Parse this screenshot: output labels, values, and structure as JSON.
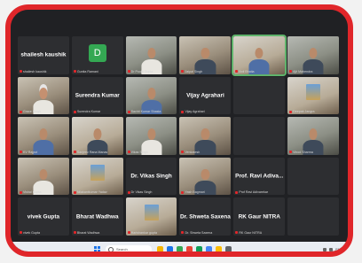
{
  "meeting": {
    "tiles": [
      {
        "kind": "name",
        "big": "shailesh kaushik",
        "tag": "shailesh kaushik"
      },
      {
        "kind": "avatar",
        "letter": "D",
        "tag": "Gunita Ramani"
      },
      {
        "kind": "video",
        "tag": "Dr Pooja Gupta"
      },
      {
        "kind": "video",
        "tag": "Jaipal Singh"
      },
      {
        "kind": "video",
        "active": true,
        "tag": "Anil Bhatia"
      },
      {
        "kind": "video",
        "tag": "Ajit Mahendra"
      },
      {
        "kind": "video",
        "tag": "Grace Singh"
      },
      {
        "kind": "name",
        "big": "Surendra Kumar",
        "tag": "Surendra Kumar"
      },
      {
        "kind": "video",
        "tag": "Sachit Kumar Shasta"
      },
      {
        "kind": "name",
        "big": "Vijay Agrahari",
        "tag": "Vijay Agrahari"
      },
      {
        "kind": "blank",
        "tag": ""
      },
      {
        "kind": "image",
        "tag": "Deepak Jangra"
      },
      {
        "kind": "video",
        "tag": "KV Rajput"
      },
      {
        "kind": "video",
        "tag": "Sanjeev Rana Manas"
      },
      {
        "kind": "video",
        "tag": "Vikas Singh"
      },
      {
        "kind": "video",
        "tag": "Venkatesh"
      },
      {
        "kind": "blank",
        "tag": ""
      },
      {
        "kind": "video",
        "tag": "Vinod Sharma"
      },
      {
        "kind": "video",
        "tag": "Vishal Gupta"
      },
      {
        "kind": "image",
        "tag": "Nilakantkumar Yadav"
      },
      {
        "kind": "name",
        "big": "Dr. Vikas Singh",
        "tag": "Dr Vikas Singh"
      },
      {
        "kind": "video",
        "tag": "Yash Bagmari"
      },
      {
        "kind": "name",
        "big": "Prof. Ravi Adiva...",
        "tag": "Prof Ravi Adivarekar"
      },
      {
        "kind": "blank",
        "tag": ""
      },
      {
        "kind": "name",
        "big": "vivek Gupta",
        "tag": "vivek Gupta"
      },
      {
        "kind": "name",
        "big": "Bharat Wadhwa",
        "tag": "Bharat Wadhwa"
      },
      {
        "kind": "image",
        "tag": "Harishankar gupta"
      },
      {
        "kind": "name",
        "big": "Dr. Shweta Saxena",
        "tag": "Dr. Shweta Saxena"
      },
      {
        "kind": "name",
        "big": "RK Gaur NITRA",
        "tag": "RK Gaur NITRA"
      },
      {
        "kind": "blank",
        "tag": ""
      }
    ]
  },
  "taskbar": {
    "search_placeholder": "Search",
    "tray_lang": "ENG",
    "apps": [
      "#f4b400",
      "#1a73e8",
      "#34a853",
      "#ea4335",
      "#0f9d58",
      "#4285f4",
      "#fbbc05",
      "#5f6368"
    ]
  },
  "colors": {
    "frame": "#e0262a",
    "meet_bg": "#202124"
  }
}
